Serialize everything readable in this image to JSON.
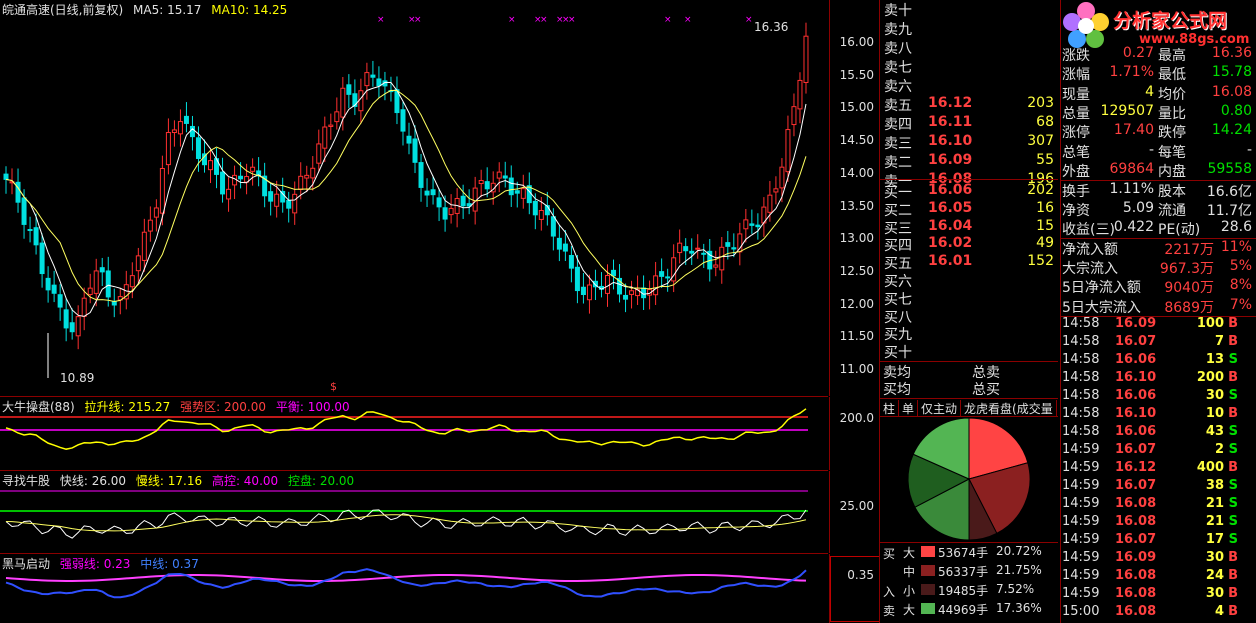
{
  "chart_title": "皖通高速(日线,前复权)",
  "ma5_label": "MA5: 15.17",
  "ma10_label": "MA10: 14.25",
  "high_label": "16.36",
  "low_label": "10.89",
  "y_ticks": [
    "16.00",
    "15.50",
    "15.00",
    "14.50",
    "14.00",
    "13.50",
    "13.00",
    "12.50",
    "12.00",
    "11.50",
    "11.00"
  ],
  "ind1": {
    "name": "大牛操盘(88)",
    "l1": "拉升线: 215.27",
    "l2": "强势区: 200.00",
    "l3": "平衡: 100.00",
    "tick": "200.0"
  },
  "ind2": {
    "name": "寻找牛股",
    "l1": "快线: 26.00",
    "l2": "慢线: 17.16",
    "l3": "高控: 40.00",
    "l4": "控盘: 20.00",
    "tick": "25.00"
  },
  "ind3": {
    "name": "黑马启动",
    "l1": "强弱线: 0.23",
    "l2": "中线: 0.37",
    "tick": "0.35"
  },
  "logo": {
    "title": "分析家公式网",
    "url": "www.88gs.com"
  },
  "sell_orders": [
    {
      "n": "卖十",
      "p": "",
      "v": ""
    },
    {
      "n": "卖九",
      "p": "",
      "v": ""
    },
    {
      "n": "卖八",
      "p": "",
      "v": ""
    },
    {
      "n": "卖七",
      "p": "",
      "v": ""
    },
    {
      "n": "卖六",
      "p": "",
      "v": ""
    },
    {
      "n": "卖五",
      "p": "16.12",
      "v": "203"
    },
    {
      "n": "卖四",
      "p": "16.11",
      "v": "68"
    },
    {
      "n": "卖三",
      "p": "16.10",
      "v": "307"
    },
    {
      "n": "卖二",
      "p": "16.09",
      "v": "55"
    },
    {
      "n": "卖一",
      "p": "16.08",
      "v": "196"
    }
  ],
  "buy_orders": [
    {
      "n": "买一",
      "p": "16.06",
      "v": "202"
    },
    {
      "n": "买二",
      "p": "16.05",
      "v": "16"
    },
    {
      "n": "买三",
      "p": "16.04",
      "v": "15"
    },
    {
      "n": "买四",
      "p": "16.02",
      "v": "49"
    },
    {
      "n": "买五",
      "p": "16.01",
      "v": "152"
    },
    {
      "n": "买六",
      "p": "",
      "v": ""
    },
    {
      "n": "买七",
      "p": "",
      "v": ""
    },
    {
      "n": "买八",
      "p": "",
      "v": ""
    },
    {
      "n": "买九",
      "p": "",
      "v": ""
    },
    {
      "n": "买十",
      "p": "",
      "v": ""
    }
  ],
  "avg": {
    "sell_avg": "卖均",
    "buy_avg": "买均",
    "total_sell": "总卖",
    "total_buy": "总买"
  },
  "tabs": [
    "柱",
    "单",
    "仅主动",
    "龙虎看盘(成交量"
  ],
  "pie": {
    "values": [
      20.72,
      21.75,
      7.52,
      17.36,
      14.3,
      18.35
    ],
    "colors": [
      "#ff4444",
      "#8b2020",
      "#4a1a1a",
      "#3a8a3a",
      "#1f5e1f",
      "#53b553"
    ]
  },
  "flow": {
    "buy_label": "买",
    "in_label": "入",
    "sell_label": "卖",
    "rows": [
      {
        "size": "大",
        "qty": "53674手",
        "pct": "20.72%",
        "color": "#ff4444"
      },
      {
        "size": "中",
        "qty": "56337手",
        "pct": "21.75%",
        "color": "#8b2020"
      },
      {
        "size": "小",
        "qty": "19485手",
        "pct": "7.52%",
        "color": "#4a1a1a"
      },
      {
        "size": "大",
        "qty": "44969手",
        "pct": "17.36%",
        "color": "#53b553"
      }
    ]
  },
  "quote": [
    {
      "k1": "涨跌",
      "v1": "0.27",
      "c1": "red",
      "k2": "最高",
      "v2": "16.36",
      "c2": "red"
    },
    {
      "k1": "涨幅",
      "v1": "1.71%",
      "c1": "red",
      "k2": "最低",
      "v2": "15.78",
      "c2": "green"
    },
    {
      "k1": "现量",
      "v1": "4",
      "c1": "yellow",
      "k2": "均价",
      "v2": "16.08",
      "c2": "red"
    },
    {
      "k1": "总量",
      "v1": "129507",
      "c1": "yellow",
      "k2": "量比",
      "v2": "0.80",
      "c2": "green"
    },
    {
      "k1": "涨停",
      "v1": "17.40",
      "c1": "red",
      "k2": "跌停",
      "v2": "14.24",
      "c2": "green"
    },
    {
      "k1": "总笔",
      "v1": "-",
      "c1": "white",
      "k2": "每笔",
      "v2": "-",
      "c2": "white"
    },
    {
      "k1": "外盘",
      "v1": "69864",
      "c1": "red",
      "k2": "内盘",
      "v2": "59558",
      "c2": "green"
    }
  ],
  "fundamentals": [
    {
      "k1": "换手",
      "v1": "1.11%",
      "k2": "股本",
      "v2": "16.6亿"
    },
    {
      "k1": "净资",
      "v1": "5.09",
      "k2": "流通",
      "v2": "11.7亿"
    },
    {
      "k1": "收益(三)",
      "v1": "0.422",
      "k2": "PE(动)",
      "v2": "28.6"
    }
  ],
  "capital": [
    {
      "k": "净流入额",
      "v": "2217万",
      "p": "11%"
    },
    {
      "k": "大宗流入",
      "v": "967.3万",
      "p": "5%"
    },
    {
      "k": "5日净流入额",
      "v": "9040万",
      "p": "8%"
    },
    {
      "k": "5日大宗流入",
      "v": "8689万",
      "p": "7%"
    }
  ],
  "ticks": [
    {
      "t": "14:58",
      "p": "16.09",
      "v": "100",
      "s": "B"
    },
    {
      "t": "14:58",
      "p": "16.07",
      "v": "7",
      "s": "B"
    },
    {
      "t": "14:58",
      "p": "16.06",
      "v": "13",
      "s": "S"
    },
    {
      "t": "14:58",
      "p": "16.10",
      "v": "200",
      "s": "B"
    },
    {
      "t": "14:58",
      "p": "16.06",
      "v": "30",
      "s": "S"
    },
    {
      "t": "14:58",
      "p": "16.10",
      "v": "10",
      "s": "B"
    },
    {
      "t": "14:58",
      "p": "16.06",
      "v": "43",
      "s": "S"
    },
    {
      "t": "14:59",
      "p": "16.07",
      "v": "2",
      "s": "S"
    },
    {
      "t": "14:59",
      "p": "16.12",
      "v": "400",
      "s": "B"
    },
    {
      "t": "14:59",
      "p": "16.07",
      "v": "38",
      "s": "S"
    },
    {
      "t": "14:59",
      "p": "16.08",
      "v": "21",
      "s": "S"
    },
    {
      "t": "14:59",
      "p": "16.08",
      "v": "21",
      "s": "S"
    },
    {
      "t": "14:59",
      "p": "16.07",
      "v": "17",
      "s": "S"
    },
    {
      "t": "14:59",
      "p": "16.09",
      "v": "30",
      "s": "B"
    },
    {
      "t": "14:59",
      "p": "16.08",
      "v": "24",
      "s": "B"
    },
    {
      "t": "14:59",
      "p": "16.08",
      "v": "30",
      "s": "B"
    },
    {
      "t": "15:00",
      "p": "16.08",
      "v": "4",
      "s": "B"
    }
  ]
}
